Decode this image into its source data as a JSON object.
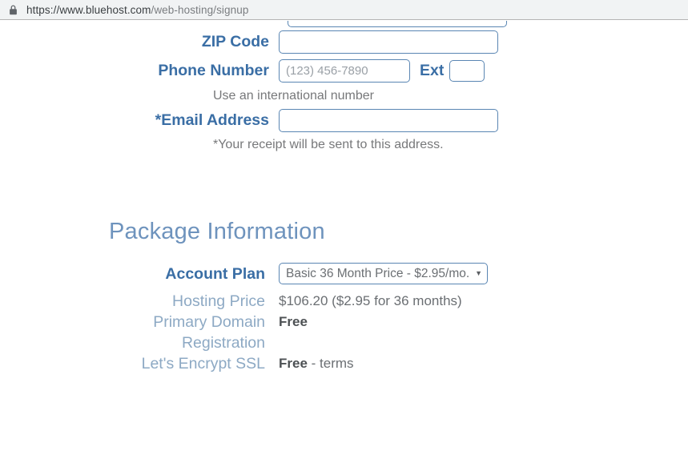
{
  "browser": {
    "lock_icon": "lock-icon",
    "url_secure_prefix": "https://www.bluehost.com",
    "url_path": "/web-hosting/signup"
  },
  "form": {
    "zip": {
      "label": "ZIP Code",
      "value": "",
      "placeholder": ""
    },
    "phone": {
      "label": "Phone Number",
      "value": "",
      "placeholder": "(123) 456-7890"
    },
    "ext": {
      "label": "Ext",
      "value": "",
      "placeholder": ""
    },
    "email": {
      "label": "*Email Address",
      "value": "",
      "placeholder": ""
    },
    "help_international": "Use an international number",
    "help_receipt": "*Your receipt will be sent to this address."
  },
  "package": {
    "heading": "Package Information",
    "account_plan": {
      "label": "Account Plan",
      "selected": "Basic 36 Month Price - $2.95/mo.",
      "caret": "▼"
    },
    "rows": [
      {
        "label": "Hosting Price",
        "value": "$106.20  ($2.95 for 36 months)"
      },
      {
        "label_line1": "Primary Domain",
        "label_line2": "Registration",
        "value": "Free"
      },
      {
        "label": "Let's Encrypt SSL",
        "value": "Free",
        "separator": " - ",
        "link": "terms"
      }
    ]
  },
  "colors": {
    "label_blue": "#3a6ea5",
    "label_light_blue": "#8da9c4",
    "heading_blue": "#6e93bd",
    "input_border": "#5a86b3",
    "chrome_bg": "#f1f3f4",
    "link_blue": "#4a7fb5"
  }
}
